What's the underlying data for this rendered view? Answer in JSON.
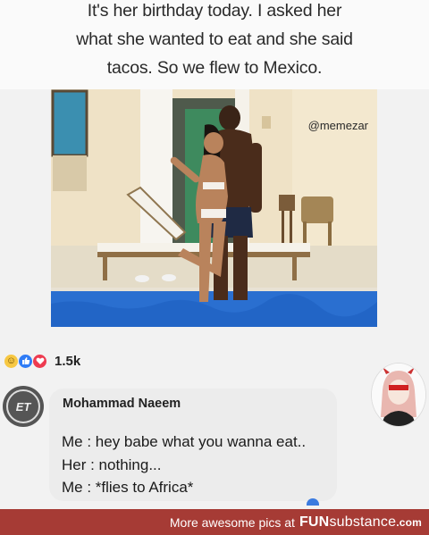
{
  "caption": {
    "line1": "It's her birthday today. I asked her",
    "line2": "what she wanted to eat and she said",
    "line3": "tacos. So we flew to Mexico."
  },
  "photo": {
    "watermark": "@memezar"
  },
  "reactions": {
    "icons": [
      "haha-icon",
      "like-icon",
      "love-icon"
    ],
    "count": "1.5k"
  },
  "comment": {
    "author": "Mohammad Naeem",
    "avatar_initials": "ET",
    "lines": [
      "Me : hey babe what you wanna eat..",
      "Her : nothing...",
      "Me : *flies to Africa*"
    ]
  },
  "footer": {
    "prefix": "More awesome pics at",
    "brand_fun": "FUN",
    "brand_rest": "substance",
    "brand_tld": ".com"
  },
  "colors": {
    "footer_bg": "#a63b35",
    "like_blue": "#2f7cf6",
    "love_red": "#ee3b50",
    "haha_yellow": "#f7c843"
  }
}
